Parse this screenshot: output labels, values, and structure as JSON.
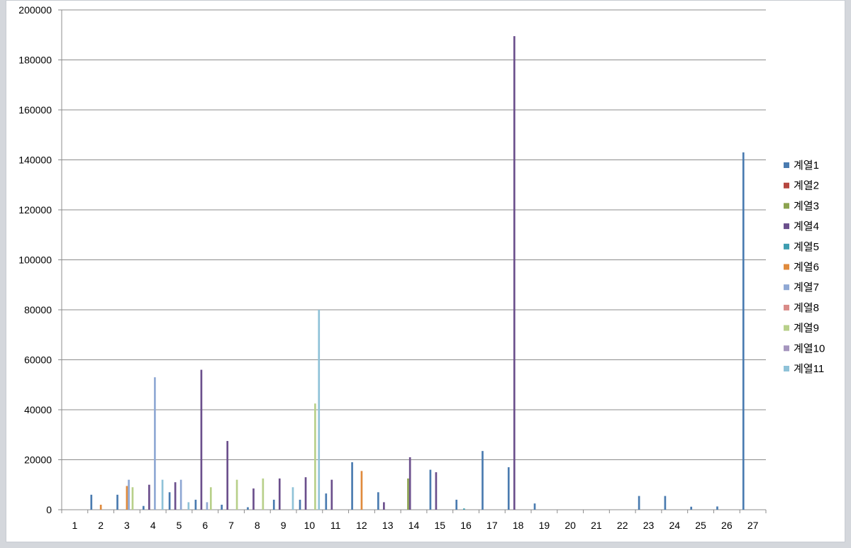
{
  "chart_data": {
    "type": "bar",
    "title": "",
    "xlabel": "",
    "ylabel": "",
    "ylim": [
      0,
      200000
    ],
    "yticks": [
      0,
      20000,
      40000,
      60000,
      80000,
      100000,
      120000,
      140000,
      160000,
      180000,
      200000
    ],
    "ytick_labels": [
      "0",
      "20000",
      "40000",
      "60000",
      "80000",
      "100000",
      "120000",
      "140000",
      "160000",
      "180000",
      "200000"
    ],
    "categories": [
      "1",
      "2",
      "3",
      "4",
      "5",
      "6",
      "7",
      "8",
      "9",
      "10",
      "11",
      "12",
      "13",
      "14",
      "15",
      "16",
      "17",
      "18",
      "19",
      "20",
      "21",
      "22",
      "23",
      "24",
      "25",
      "26",
      "27"
    ],
    "grid": true,
    "legend_position": "right",
    "series": [
      {
        "name": "계열1",
        "color": "#4a7bb0",
        "values": [
          0,
          6000,
          6000,
          1500,
          7000,
          4000,
          2000,
          1000,
          4000,
          4000,
          6500,
          19000,
          7000,
          0,
          16000,
          4000,
          23500,
          17000,
          2500,
          0,
          0,
          0,
          5500,
          5500,
          1200,
          1300,
          143000
        ]
      },
      {
        "name": "계열2",
        "color": "#b5463f",
        "values": [
          0,
          0,
          0,
          0,
          0,
          0,
          0,
          0,
          0,
          0,
          0,
          0,
          0,
          0,
          0,
          0,
          0,
          0,
          0,
          0,
          0,
          0,
          0,
          0,
          0,
          0,
          0
        ]
      },
      {
        "name": "계열3",
        "color": "#8ca34f",
        "values": [
          0,
          0,
          0,
          0,
          0,
          0,
          0,
          0,
          0,
          0,
          0,
          0,
          0,
          12500,
          0,
          0,
          0,
          0,
          0,
          0,
          0,
          0,
          0,
          0,
          0,
          0,
          0
        ]
      },
      {
        "name": "계열4",
        "color": "#6b4f8c",
        "values": [
          0,
          0,
          0,
          10000,
          11000,
          56000,
          27500,
          8500,
          12500,
          13000,
          12000,
          0,
          3000,
          21000,
          15000,
          0,
          0,
          189500,
          0,
          0,
          0,
          0,
          0,
          0,
          0,
          0,
          0
        ]
      },
      {
        "name": "계열5",
        "color": "#3e9db0",
        "values": [
          0,
          0,
          0,
          0,
          0,
          0,
          0,
          0,
          0,
          0,
          0,
          0,
          0,
          0,
          0,
          500,
          0,
          0,
          0,
          0,
          0,
          0,
          0,
          0,
          0,
          0,
          0
        ]
      },
      {
        "name": "계열6",
        "color": "#e08a3c",
        "values": [
          0,
          2000,
          9500,
          0,
          0,
          0,
          0,
          0,
          0,
          0,
          0,
          15500,
          0,
          0,
          0,
          0,
          0,
          0,
          0,
          0,
          0,
          0,
          0,
          0,
          0,
          0,
          0
        ]
      },
      {
        "name": "계열7",
        "color": "#8fa8d4",
        "values": [
          0,
          0,
          12000,
          53000,
          12000,
          3000,
          0,
          0,
          0,
          0,
          0,
          0,
          0,
          0,
          0,
          0,
          0,
          0,
          0,
          0,
          0,
          0,
          0,
          0,
          0,
          0,
          0
        ]
      },
      {
        "name": "계열8",
        "color": "#d98b88",
        "values": [
          0,
          0,
          0,
          0,
          0,
          0,
          0,
          0,
          0,
          0,
          0,
          0,
          0,
          0,
          0,
          0,
          0,
          0,
          0,
          0,
          0,
          0,
          0,
          0,
          0,
          0,
          0
        ]
      },
      {
        "name": "계열9",
        "color": "#b8d08a",
        "values": [
          0,
          0,
          9000,
          0,
          0,
          9000,
          12000,
          12500,
          0,
          42500,
          0,
          0,
          0,
          0,
          0,
          0,
          0,
          0,
          0,
          0,
          0,
          0,
          0,
          0,
          0,
          0,
          0
        ]
      },
      {
        "name": "계열10",
        "color": "#a595be",
        "values": [
          0,
          0,
          0,
          0,
          0,
          0,
          0,
          0,
          0,
          0,
          0,
          0,
          0,
          0,
          0,
          0,
          0,
          0,
          0,
          0,
          0,
          0,
          0,
          0,
          0,
          0,
          0
        ]
      },
      {
        "name": "계열11",
        "color": "#8fc2d8",
        "values": [
          0,
          0,
          0,
          12000,
          3000,
          0,
          0,
          0,
          9000,
          80000,
          0,
          0,
          0,
          0,
          0,
          0,
          0,
          0,
          0,
          0,
          0,
          0,
          0,
          0,
          0,
          0,
          0
        ]
      }
    ]
  }
}
